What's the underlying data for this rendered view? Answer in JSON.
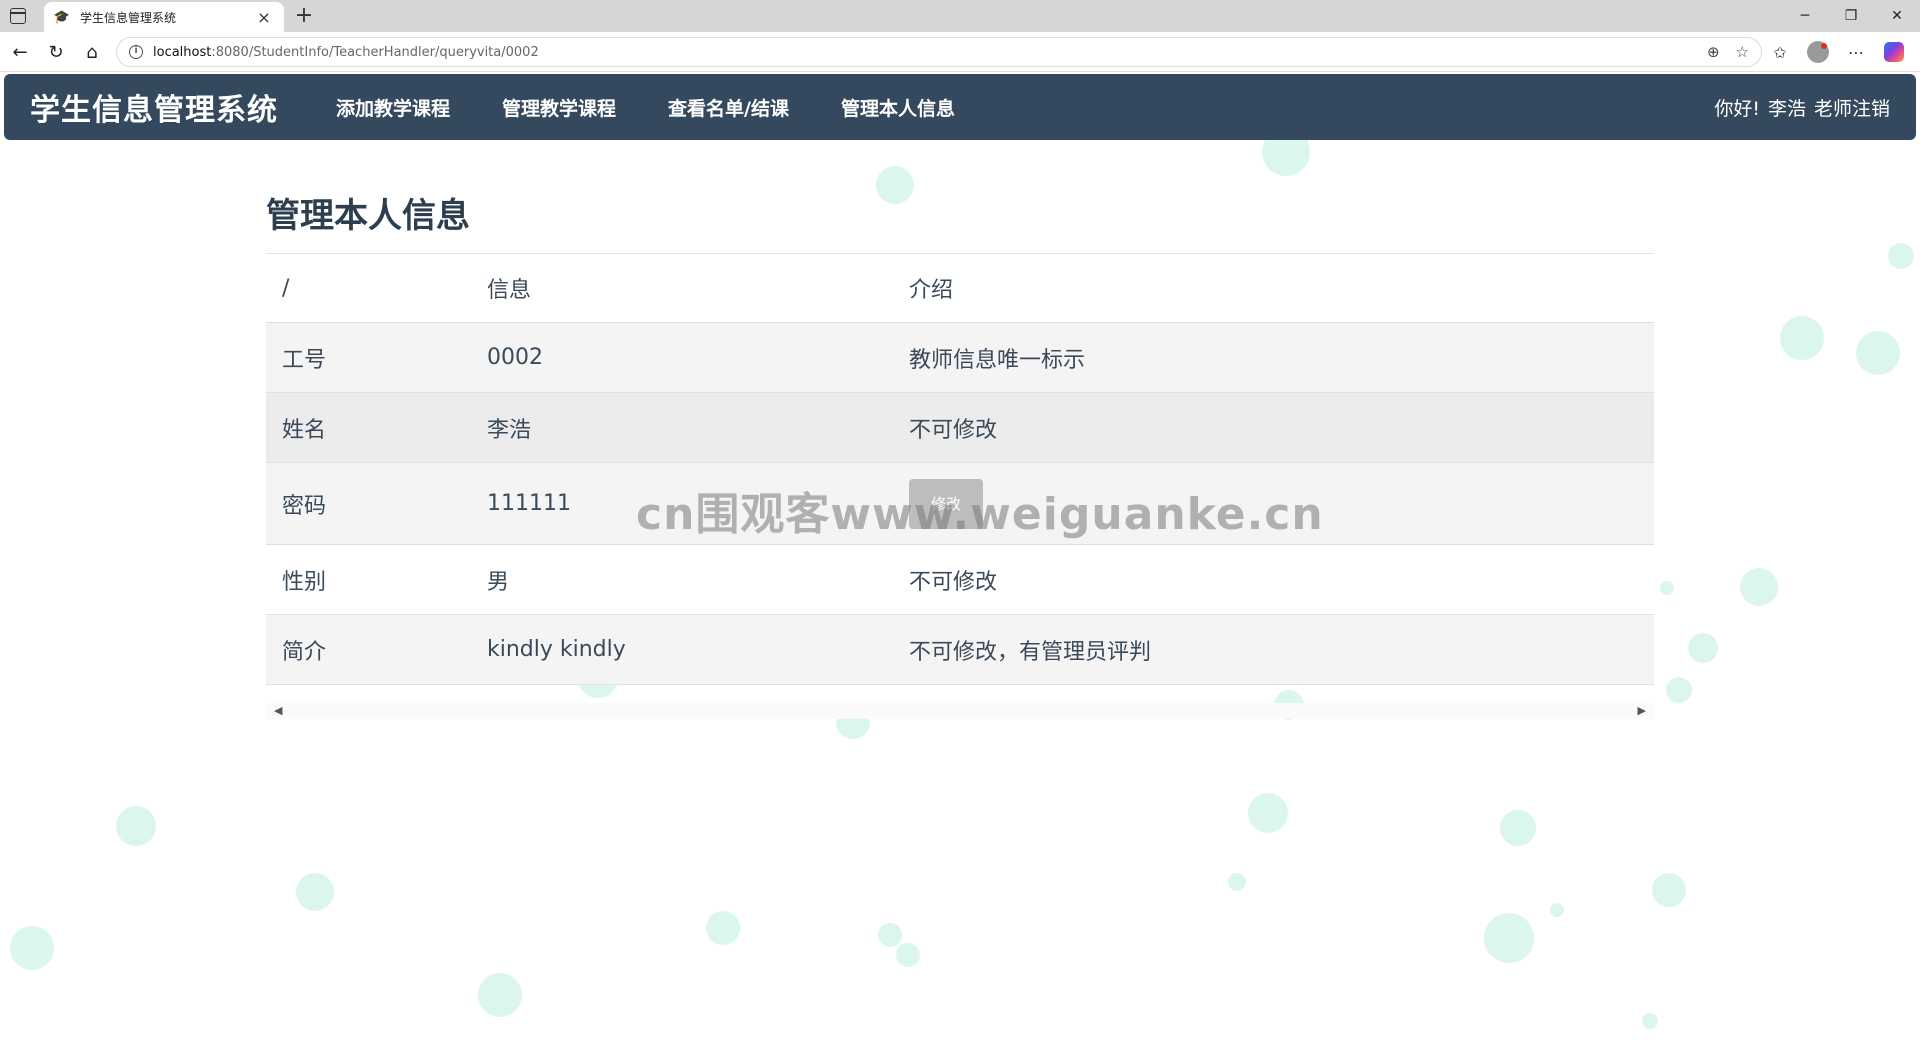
{
  "browser": {
    "tab_title": "学生信息管理系统",
    "tab_favicon": "🎓",
    "close_glyph": "×",
    "newtab_glyph": "+",
    "url_host": "localhost",
    "url_path": ":8080/StudentInfo/TeacherHandler/queryvita/0002",
    "info_glyph": "i"
  },
  "navbar": {
    "brand": "学生信息管理系统",
    "links": [
      "添加教学课程",
      "管理教学课程",
      "查看名单/结课",
      "管理本人信息"
    ],
    "greeting": "你好!",
    "user_name": "李浩",
    "logout": "老师注销"
  },
  "page": {
    "title": "管理本人信息"
  },
  "table": {
    "headers": [
      "/",
      "信息",
      "介绍"
    ],
    "rows": [
      {
        "label": "工号",
        "value": "0002",
        "note": "教师信息唯一标示"
      },
      {
        "label": "姓名",
        "value": "李浩",
        "note": "不可修改"
      },
      {
        "label": "密码",
        "value": "111111",
        "button": "修改"
      },
      {
        "label": "性别",
        "value": "男",
        "note": "不可修改"
      },
      {
        "label": "简介",
        "value": "kindly kindly",
        "note": "不可修改，有管理员评判"
      }
    ]
  },
  "watermark": "cn围观客www.weiguanke.cn",
  "colors": {
    "navbar": "#34495e",
    "title": "#2c3e50",
    "bubble": "#98e1d2"
  }
}
